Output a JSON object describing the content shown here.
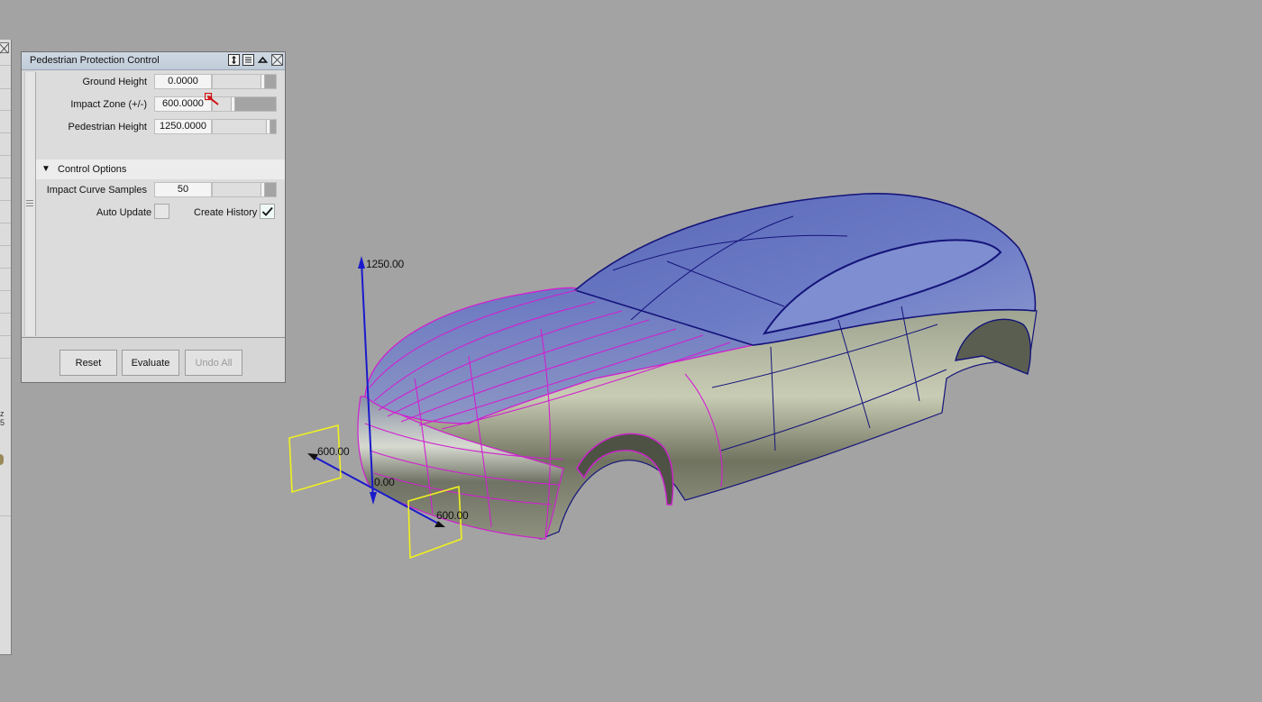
{
  "dialog": {
    "title": "Pedestrian Protection Control",
    "title_icons": [
      "resize-vertical-icon",
      "options-list-icon",
      "collapse-up-icon",
      "close-icon"
    ],
    "fields": [
      {
        "label": "Ground Height",
        "value": "0.0000",
        "slider_fraction": 0.82
      },
      {
        "label": "Impact Zone (+/-)",
        "value": "600.0000",
        "slider_fraction": 0.3
      },
      {
        "label": "Pedestrian Height",
        "value": "1250.0000",
        "slider_fraction": 0.9
      }
    ],
    "section": {
      "label": "Control Options",
      "expanded": true,
      "samples": {
        "label": "Impact Curve Samples",
        "value": "50",
        "slider_fraction": 0.82
      },
      "auto_update": {
        "label": "Auto Update",
        "checked": false
      },
      "create_history": {
        "label": "Create History",
        "checked": true
      }
    },
    "buttons": {
      "reset": "Reset",
      "evaluate": "Evaluate",
      "undo_all": "Undo All"
    }
  },
  "viewport": {
    "dimension_labels": {
      "height": "1250.00",
      "origin": "0.00",
      "zone_left": "600.00",
      "zone_right": "600.00"
    },
    "colors": {
      "background": "#a3a3a3",
      "axis": "#1a1acc",
      "impact_curves": "#d020d0",
      "zone_markers": "#f0f020",
      "body_edges": "#14147a"
    }
  },
  "left_panel": {
    "fragments": [
      "z",
      "5"
    ]
  }
}
